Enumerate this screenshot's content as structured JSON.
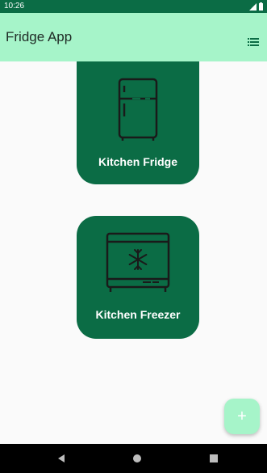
{
  "status_bar": {
    "time": "10:26",
    "icons": [
      "signal-icon",
      "battery-icon"
    ]
  },
  "app_bar": {
    "title": "Fridge App",
    "menu_icon": "list-icon"
  },
  "cards": [
    {
      "label": "Kitchen Fridge",
      "icon": "fridge-icon"
    },
    {
      "label": "Kitchen Freezer",
      "icon": "freezer-icon"
    }
  ],
  "fab": {
    "label": "+",
    "icon": "add-icon"
  },
  "nav_bar": {
    "buttons": [
      "back-icon",
      "home-icon",
      "recents-icon"
    ]
  },
  "colors": {
    "primary": "#0b6c45",
    "primary_light": "#a6f4c9",
    "background": "#fafafa"
  }
}
